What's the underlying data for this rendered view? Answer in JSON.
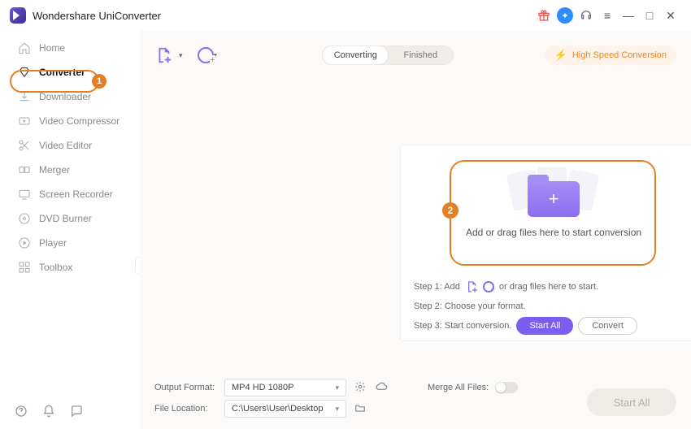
{
  "app": {
    "name": "Wondershare UniConverter"
  },
  "titlebar": {
    "min": "—",
    "max": "□",
    "close": "✕",
    "menu": "≡"
  },
  "sidebar": {
    "items": [
      {
        "label": "Home"
      },
      {
        "label": "Converter"
      },
      {
        "label": "Downloader"
      },
      {
        "label": "Video Compressor"
      },
      {
        "label": "Video Editor"
      },
      {
        "label": "Merger"
      },
      {
        "label": "Screen Recorder"
      },
      {
        "label": "DVD Burner"
      },
      {
        "label": "Player"
      },
      {
        "label": "Toolbox"
      }
    ],
    "badge1": "1"
  },
  "tabs": {
    "converting": "Converting",
    "finished": "Finished"
  },
  "hsconv": "High Speed Conversion",
  "drop": {
    "text": "Add or drag files here to start conversion",
    "badge2": "2"
  },
  "steps": {
    "s1a": "Step 1: Add",
    "s1b": "or drag files here to start.",
    "s2": "Step 2: Choose your format.",
    "s3": "Step 3: Start conversion.",
    "startall": "Start All",
    "convert": "Convert"
  },
  "bottom": {
    "outfmt_label": "Output Format:",
    "outfmt_value": "MP4 HD 1080P",
    "fileloc_label": "File Location:",
    "fileloc_value": "C:\\Users\\User\\Desktop",
    "merge_label": "Merge All Files:",
    "startall": "Start All"
  }
}
